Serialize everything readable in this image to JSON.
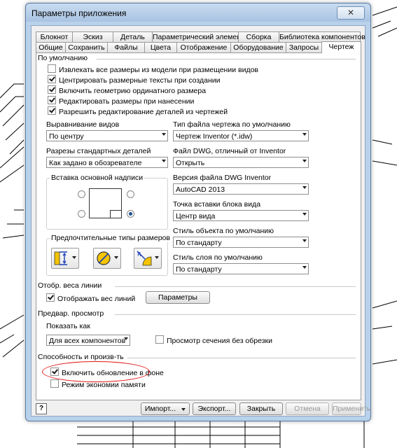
{
  "window": {
    "title": "Параметры приложения",
    "close_glyph": "✕"
  },
  "tabs_row1": [
    {
      "label": "Блокнот"
    },
    {
      "label": "Эскиз"
    },
    {
      "label": "Деталь"
    },
    {
      "label": "Параметрический элемент"
    },
    {
      "label": "Сборка"
    },
    {
      "label": "Библиотека компонентов"
    }
  ],
  "tabs_row2": [
    {
      "label": "Общие"
    },
    {
      "label": "Сохранить"
    },
    {
      "label": "Файлы"
    },
    {
      "label": "Цвета"
    },
    {
      "label": "Отображение"
    },
    {
      "label": "Оборудование"
    },
    {
      "label": "Запросы"
    },
    {
      "label": "Чертеж",
      "active": true
    }
  ],
  "defaults": {
    "header": "По умолчанию",
    "checkboxes": [
      {
        "label": "Извлекать все размеры из модели при размещении видов",
        "checked": false
      },
      {
        "label": "Центрировать размерные тексты при создании",
        "checked": true
      },
      {
        "label": "Включить геометрию ординатного размера",
        "checked": true
      },
      {
        "label": "Редактировать размеры при нанесении",
        "checked": true
      },
      {
        "label": "Разрешить редактирование деталей из чертежей",
        "checked": true
      }
    ],
    "view_justification": {
      "label": "Выравнивание видов",
      "value": "По центру"
    },
    "drawing_file_type": {
      "label": "Тип файла чертежа по умолчанию",
      "value": "Чертеж Inventor (*.idw)"
    },
    "section_standard_parts": {
      "label": "Разрезы стандартных деталей",
      "value": "Как задано в обозревателе"
    },
    "non_inventor_dwg": {
      "label": "Файл DWG, отличный от Inventor",
      "value": "Открыть"
    },
    "title_block_insertion": {
      "label": "Вставка основной надписи"
    },
    "dwg_version": {
      "label": "Версия файла DWG Inventor",
      "value": "AutoCAD 2013"
    },
    "view_block_insertion": {
      "label": "Точка вставки блока вида",
      "value": "Центр вида"
    },
    "object_style": {
      "label": "Стиль объекта по умолчанию",
      "value": "По стандарту"
    },
    "layer_style": {
      "label": "Стиль слоя по умолчанию",
      "value": "По стандарту"
    },
    "dimension_types": {
      "label": "Предпочтительные типы размеров",
      "icons": [
        "linear-dimension-icon",
        "diameter-dimension-icon",
        "radius-dimension-icon"
      ]
    }
  },
  "line_weight": {
    "header": "Отобр. веса линии",
    "checkbox": {
      "label": "Отображать вес линий",
      "checked": true
    },
    "settings_button": "Параметры"
  },
  "preview": {
    "header": "Предвар. просмотр",
    "show_as_label": "Показать как",
    "show_as_value": "Для всех компонентов",
    "unclipped_section": {
      "label": "Просмотр сечения без обрезки",
      "checked": false
    }
  },
  "performance": {
    "header": "Способность и произв-ть",
    "background_update": {
      "label": "Включить обновление в фоне",
      "checked": true
    },
    "memory_saving": {
      "label": "Режим экономии памяти",
      "checked": false
    }
  },
  "footer": {
    "help": "?",
    "import": "Импорт...",
    "export": "Экспорт...",
    "close": "Закрыть",
    "cancel": "Отмена",
    "apply": "Применить"
  },
  "colors": {
    "annotation_ellipse": "#e01515",
    "dialog_frame": "#b9d1ea"
  }
}
